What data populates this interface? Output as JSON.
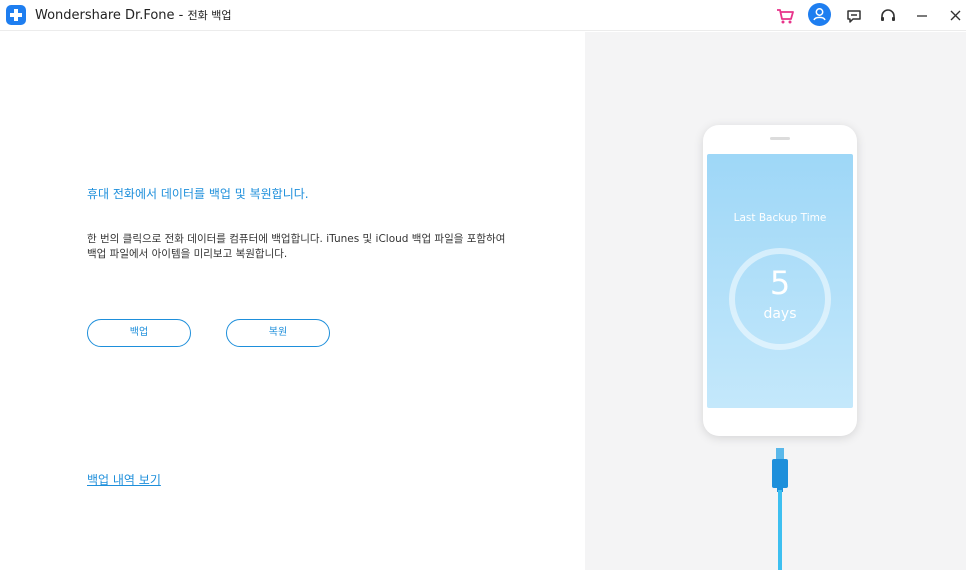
{
  "app": {
    "name": "Wondershare Dr.Fone",
    "separator": " - ",
    "section": "전화 백업"
  },
  "titlebar": {
    "icons": [
      "cart-icon",
      "account-icon",
      "feedback-icon",
      "headset-icon",
      "minimize-icon",
      "close-icon"
    ]
  },
  "main": {
    "heading": "휴대 전화에서 데이터를 백업 및 복원합니다.",
    "description": "한 번의 클릭으로 전화 데이터를 컴퓨터에 백업합니다. iTunes 및 iCloud 백업 파일을 포함하여 백업 파일에서 아이템을 미리보고 복원합니다.",
    "backup_button": "백업",
    "restore_button": "복원",
    "history_link": "백업 내역 보기"
  },
  "phone": {
    "last_backup_label": "Last Backup Time",
    "days_value": "5",
    "days_unit": "days"
  },
  "colors": {
    "accent": "#1e8fdb",
    "brand": "#1e7ef0",
    "cable": "#3dbff0",
    "panel_bg": "#f4f4f5"
  }
}
